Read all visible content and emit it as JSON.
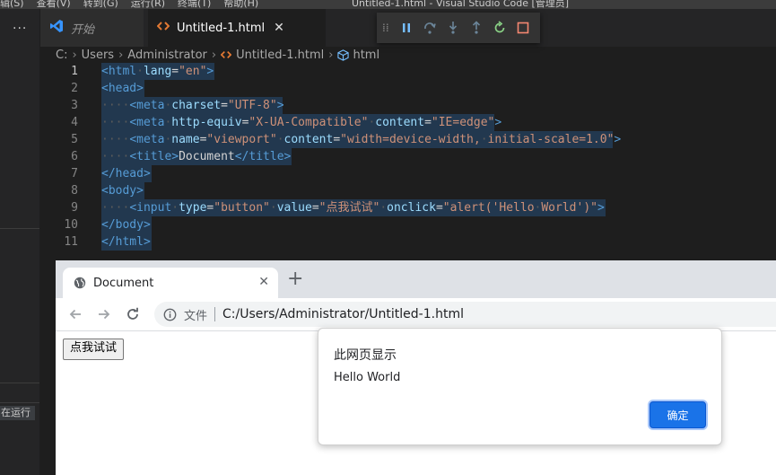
{
  "window": {
    "menu": [
      "辑(S)",
      "查看(V)",
      "转到(G)",
      "运行(R)",
      "终端(T)",
      "帮助(H)"
    ],
    "title": "Untitled-1.html - Visual Studio Code [管理员]"
  },
  "sidebar": {
    "more": "···",
    "status": "在运行"
  },
  "tabs": [
    {
      "label": "开始",
      "icon": "vscode-logo-icon"
    },
    {
      "label": "Untitled-1.html",
      "icon": "html-file-icon",
      "close": "✕"
    }
  ],
  "debug_toolbar": [
    "grip-icon",
    "pause-icon",
    "step-over-icon",
    "step-into-icon",
    "step-out-icon",
    "restart-icon",
    "stop-icon"
  ],
  "breadcrumb": [
    "C:",
    "Users",
    "Administrator",
    "Untitled-1.html",
    "html"
  ],
  "editor": {
    "current_line": 1,
    "lines": [
      {
        "n": "1"
      },
      {
        "n": "2"
      },
      {
        "n": "3"
      },
      {
        "n": "4"
      },
      {
        "n": "5"
      },
      {
        "n": "6"
      },
      {
        "n": "7"
      },
      {
        "n": "8"
      },
      {
        "n": "9"
      },
      {
        "n": "10"
      },
      {
        "n": "11"
      }
    ]
  },
  "browser": {
    "tab_title": "Document",
    "tab_close": "✕",
    "new_tab": "+",
    "scheme_label": "文件",
    "url": "C:/Users/Administrator/Untitled-1.html",
    "page_button": "点我试试"
  },
  "dialog": {
    "title": "此网页显示",
    "message": "Hello World",
    "ok": "确定"
  }
}
